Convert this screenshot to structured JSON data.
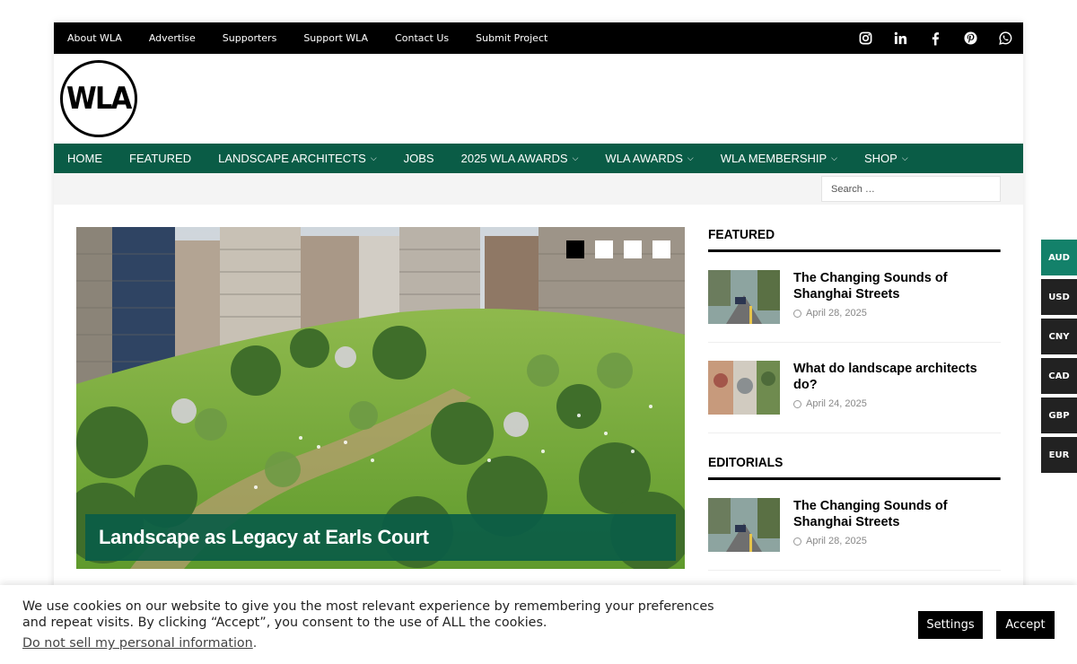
{
  "topbar": {
    "links": [
      "About WLA",
      "Advertise",
      "Supporters",
      "Support WLA",
      "Contact Us",
      "Submit Project"
    ],
    "social_icons": [
      "instagram-icon",
      "linkedin-icon",
      "facebook-icon",
      "pinterest-icon",
      "whatsapp-icon"
    ]
  },
  "logo": {
    "text": "WLA"
  },
  "nav": {
    "items": [
      {
        "label": "HOME",
        "dropdown": false
      },
      {
        "label": "FEATURED",
        "dropdown": false
      },
      {
        "label": "LANDSCAPE ARCHITECTS",
        "dropdown": true
      },
      {
        "label": "JOBS",
        "dropdown": false
      },
      {
        "label": "2025 WLA AWARDS",
        "dropdown": true
      },
      {
        "label": "WLA AWARDS",
        "dropdown": true
      },
      {
        "label": "WLA MEMBERSHIP",
        "dropdown": true
      },
      {
        "label": "SHOP",
        "dropdown": true
      }
    ]
  },
  "search": {
    "placeholder": "Search …"
  },
  "hero": {
    "caption": "Landscape as Legacy at Earls Court",
    "slide_count": 4,
    "active_slide": 1
  },
  "sidebar": {
    "featured_title": "FEATURED",
    "featured": [
      {
        "title": "The Changing Sounds of Shanghai Streets",
        "date": "April 28, 2025"
      },
      {
        "title": "What do landscape architects do?",
        "date": "April 24, 2025"
      }
    ],
    "editorials_title": "EDITORIALS",
    "editorials": [
      {
        "title": "The Changing Sounds of Shanghai Streets",
        "date": "April 28, 2025"
      }
    ]
  },
  "currency": {
    "options": [
      "AUD",
      "USD",
      "CNY",
      "CAD",
      "GBP",
      "EUR"
    ],
    "active": "AUD"
  },
  "cookie": {
    "message": "We use cookies on our website to give you the most relevant experience by remembering your preferences and repeat visits. By clicking “Accept”, you consent to the use of ALL the cookies.",
    "dns_link": "Do not sell my personal information",
    "dns_suffix": ".",
    "settings_label": "Settings",
    "accept_label": "Accept"
  },
  "colors": {
    "brand_green": "#0a5c46",
    "currency_active": "#13816a",
    "topbar": "#000000"
  }
}
